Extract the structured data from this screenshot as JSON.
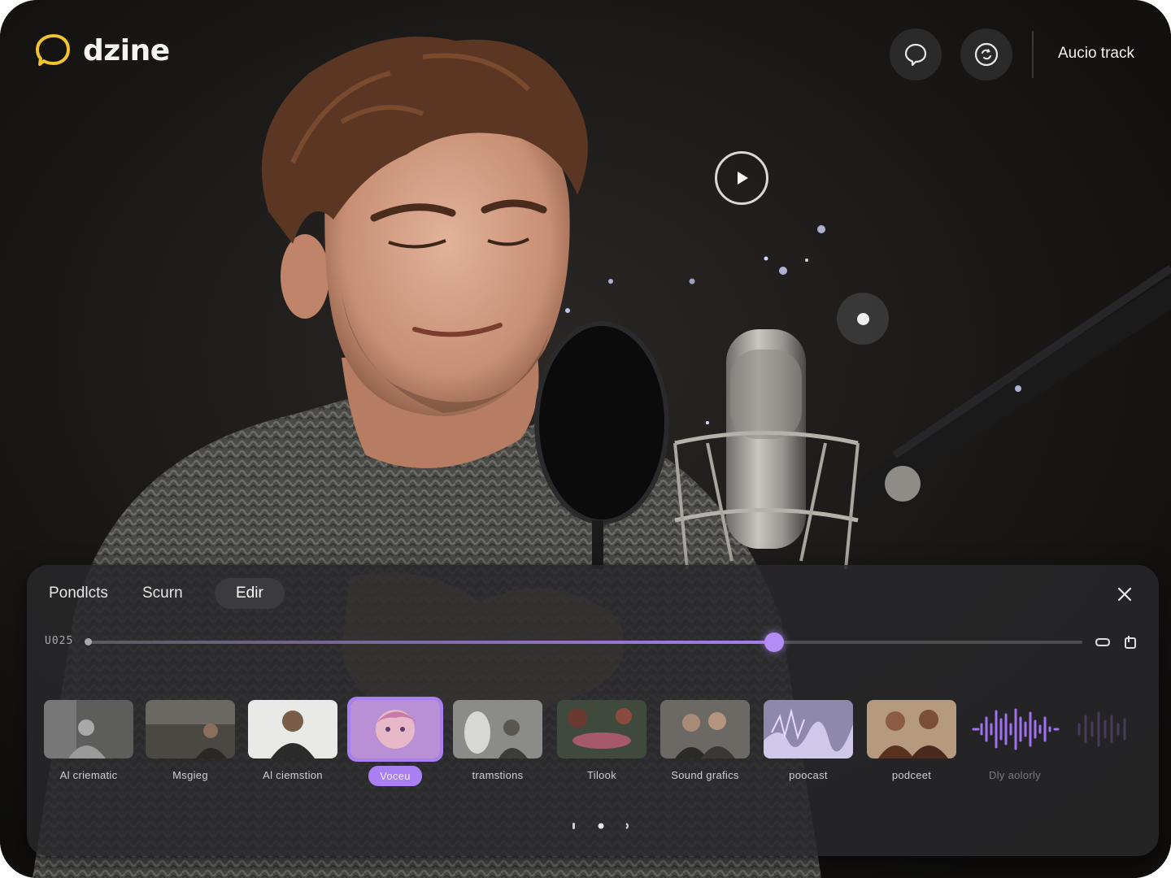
{
  "app": {
    "name": "dzine",
    "accent": "#a97ff2",
    "logo_color": "#f2c230"
  },
  "header": {
    "buttons": [
      {
        "icon": "chat-bubble-icon"
      },
      {
        "icon": "sync-circle-icon"
      }
    ],
    "audio_track_label": "Aucio track"
  },
  "preview": {
    "play_icon": "play-icon",
    "secondary_icon": "record-dot-icon"
  },
  "panel": {
    "tabs": [
      {
        "label": "Pondlcts"
      },
      {
        "label": "Scurn"
      },
      {
        "label": "Edir"
      }
    ],
    "active_tab": "Edir",
    "timecode": "U025",
    "playhead_fraction": 0.69,
    "track_icons": [
      "loop-icon",
      "export-icon"
    ],
    "close_icon": "close-icon",
    "clips": [
      {
        "label": "Al criematic",
        "tone": "#8a8a8a"
      },
      {
        "label": "Msgieg",
        "tone": "#6c6660"
      },
      {
        "label": "Al ciemstion",
        "tone": "#d8d8d6"
      },
      {
        "label": "Voceu",
        "tone": "#c6a2e0",
        "selected": true
      },
      {
        "label": "tramstions",
        "tone": "#9a9a98"
      },
      {
        "label": "Tilook",
        "tone": "#5f5a55"
      },
      {
        "label": "Sound grafics",
        "tone": "#7c7670"
      },
      {
        "label": "poocast",
        "tone": "#a8a4c8"
      },
      {
        "label": "podceet",
        "tone": "#8a6a50"
      },
      {
        "label": "Dly aolorly",
        "tone": "#a070f0",
        "waveform": true
      }
    ],
    "pager": {
      "count": 3,
      "active": 1
    }
  }
}
